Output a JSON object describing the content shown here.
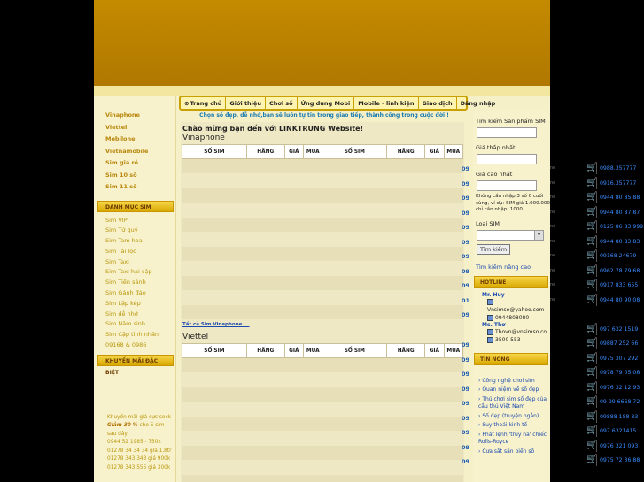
{
  "nav": {
    "items": [
      "Trang chủ",
      "Giới thiệu",
      "Chơi số",
      "Ứng dụng Mobi",
      "Mobile - linh kiện",
      "Giao dịch",
      "Đăng nhập"
    ]
  },
  "slogan": "Chọn số đẹp, dễ nhớ,bạn sẽ luôn tự tin trong giao tiếp, thành công trong cuộc đời !",
  "left": {
    "networks": [
      "Vinaphone",
      "Viettel",
      "Mobilone",
      "Vietnamobile",
      "Sim giá rẻ",
      "Sim 10 số",
      "Sim 11 số"
    ],
    "category_title": "DANH MỤC SIM",
    "categories": [
      "Sim VIP",
      "Sim Tứ quý",
      "Sim Tam hoa",
      "Sim Tài lộc",
      "Sim Taxi",
      "Sim Taxi hai cặp",
      "Sim Tiến sảnh",
      "Sim Gánh đảo",
      "Sim Lặp kép",
      "Sim dễ nhớ",
      "Sim Năm sinh",
      "Sim Cặp tình nhân",
      "09168 & 0986"
    ],
    "promo_title": "KHUYẾN MÃI ĐẶC BIỆT",
    "promo_lines": [
      "Khuyến mãi giá cực sock",
      "Giảm 30 %",
      "cho 5 sim sau đây",
      "0944 52 1985 - 750k",
      "01278 34 34 34 giá 1,8tr",
      "01278 343 343 giá 900k",
      "01278 343 555 giá 300k"
    ]
  },
  "main": {
    "welcome": "Chào mừng bạn đến với LINKTRUNG Website!",
    "sections": [
      {
        "title": "Vinaphone",
        "link": "Tất cả Sim Vinaphone ...",
        "stubs": [
          "09",
          "09",
          "09",
          "09",
          "09",
          "09",
          "09",
          "09",
          "09",
          "01",
          "09"
        ]
      },
      {
        "title": "Viettel",
        "link": "",
        "stubs": [
          "09",
          "09",
          "09",
          "09",
          "09",
          "09",
          "09",
          "09",
          "09"
        ]
      }
    ],
    "headers": [
      "SỐ SIM",
      "HÃNG",
      "GIÁ",
      "MUA",
      "SỐ SIM",
      "HÃNG",
      "GIÁ",
      "MUA"
    ]
  },
  "right": {
    "search_title": "Tìm kiếm Sản phẩm SIM",
    "price_min_label": "Giá thấp nhất",
    "price_max_label": "Giá cao nhất",
    "price_note": "Không cần nhập 3 số 0 cuối cùng, ví dụ: SIM giá 1.000.000 chỉ cần nhập: 1000",
    "sim_type_label": "Loại SIM",
    "search_button": "Tìm kiếm",
    "advanced_link": "Tìm kiếm nâng cao",
    "hotline_title": "HOTLINE",
    "contacts": [
      {
        "name": "Mr. Huy",
        "email": "Vnsimso@yahoo.com",
        "phone": "0944808080"
      },
      {
        "name": "Ms. Thơ",
        "email": "Thovn@vnsimso.co",
        "phone": "3500 553"
      }
    ],
    "news_title": "TIN NÓNG",
    "news": [
      "Công nghệ chơi sim",
      "Quan niệm về số đẹp",
      "Thú chơi sim số đẹp của cầu thủ Việt Nam",
      "Số đẹp (truyện ngắn)",
      "Suy thoái kinh tế",
      "Phát lệnh 'truy nã' chiếc Rolls-Royce",
      "Cưa sắt săn biển số"
    ]
  },
  "ticker": {
    "rows": [
      {
        "left": "ne",
        "num": "0988.357777"
      },
      {
        "left": "ne",
        "num": "0916.357777"
      },
      {
        "left": "ne",
        "num": "0944 80 85 88"
      },
      {
        "left": "ne",
        "num": "0944 80 87 87"
      },
      {
        "left": "ne",
        "num": "0125 86 83 999"
      },
      {
        "left": "ne",
        "num": "0944 80 83 83"
      },
      {
        "left": "ne",
        "num": "09168 24679"
      },
      {
        "left": "ne",
        "num": "0962 78 79 68"
      },
      {
        "left": "ne",
        "num": "0917 833 655"
      },
      {
        "left": "ne",
        "num": "0944 80 90 08"
      },
      {
        "left": "",
        "num": ""
      },
      {
        "left": "",
        "num": "097 632 1519"
      },
      {
        "left": "",
        "num": "09887 252 66"
      },
      {
        "left": "",
        "num": "0975 307 292"
      },
      {
        "left": "",
        "num": "0978 79 05 08"
      },
      {
        "left": "",
        "num": "0976 32 12 93"
      },
      {
        "left": "",
        "num": "09 99 6668 72"
      },
      {
        "left": "",
        "num": "09888 188 83"
      },
      {
        "left": "",
        "num": "097 6321415"
      },
      {
        "left": "",
        "num": "0976 321 093"
      },
      {
        "left": "",
        "num": "0975 72 36 88"
      }
    ]
  }
}
